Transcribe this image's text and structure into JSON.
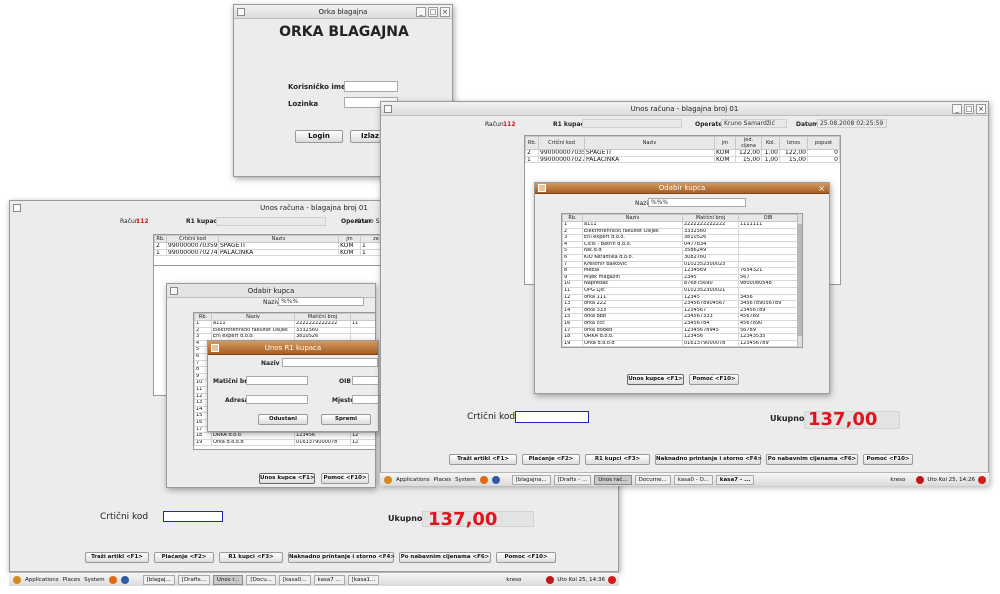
{
  "colors": {
    "accent": "#e0141c",
    "dialog_title": "#a65e25",
    "input_blue": "#1c27b8"
  },
  "login": {
    "title": "Orka blagajna",
    "heading": "ORKA BLAGAJNA",
    "user_label": "Korisničko ime",
    "pass_label": "Lozinka",
    "login_btn": "Login",
    "exit_btn": "Izlaz"
  },
  "back": {
    "title": "Unos računa - blagajna broj  01",
    "racun_label": "Račun",
    "racun_value": "112",
    "r1_label": "R1 kupac",
    "operator_label": "Operater",
    "operator_value": "Kruno Samar",
    "columns": [
      "Rb.",
      "Crtični kod",
      "Naziv",
      "jm",
      "ze"
    ],
    "rows": [
      [
        "2",
        "9900000070359",
        "ŠPAGETI",
        "KOM",
        "1"
      ],
      [
        "1",
        "9900000070274",
        "PALAČINKA",
        "KOM",
        "1"
      ]
    ],
    "barcode_label": "Crtični kod",
    "total_label": "Ukupno:",
    "total_value": "137,00",
    "buttons": [
      "Traži artikl <F1>",
      "Plaćanje <F2>",
      "R1 kupci <F3>",
      "Naknadno printanje i storno <F4>",
      "Po nabavnim cijenama <F6>",
      "Pomoć <F10>"
    ],
    "dialog": {
      "title": "Odabir kupca",
      "naziv_label": "Naziv",
      "naziv_value": "%%%",
      "columns": [
        "Rb.",
        "Naziv",
        "Matični broj",
        ""
      ],
      "rows": [
        [
          "1",
          "a111",
          "2222222222222",
          "11"
        ],
        [
          "2",
          "Elektrotehnički fakultet Osijek",
          "3332560",
          ""
        ],
        [
          "3",
          "Eni expert d.o.o.",
          "3810526",
          ""
        ],
        [
          "4",
          "",
          "",
          ""
        ],
        [
          "5",
          "",
          "",
          ""
        ],
        [
          "6",
          "",
          "",
          ""
        ],
        [
          "7",
          "",
          "",
          ""
        ],
        [
          "8",
          "",
          "",
          ""
        ],
        [
          "9",
          "",
          "",
          ""
        ],
        [
          "10",
          "",
          "",
          ""
        ],
        [
          "11",
          "",
          "",
          ""
        ],
        [
          "12",
          "",
          "",
          ""
        ],
        [
          "13",
          "",
          "",
          ""
        ],
        [
          "14",
          "",
          "",
          ""
        ],
        [
          "15",
          "",
          "",
          ""
        ],
        [
          "16",
          "",
          "",
          ""
        ],
        [
          "17",
          "",
          "",
          ""
        ],
        [
          "18",
          "DRKA d.o.o.",
          "123456",
          "12"
        ],
        [
          "19",
          "Orka d.o.o.d",
          "0161379000078",
          "12"
        ]
      ],
      "ok_btn": "Unos kupca <F1>",
      "help_btn": "Pomoć <F10>"
    },
    "r1dialog": {
      "title": "Unos R1 kupaca",
      "naziv_label": "Naziv",
      "mb_label": "Matični broj",
      "oib_label": "OIB",
      "adresa_label": "Adresa",
      "mjesto_label": "Mjesto",
      "cancel_btn": "Odustani",
      "save_btn": "Spremi"
    }
  },
  "front": {
    "title": "Unos računa - blagajna broj  01",
    "racun_label": "Račun",
    "racun_value": "112",
    "r1_label": "R1 kupac",
    "operator_label": "Operater",
    "operator_value": "Kruno Samardžić",
    "datum_label": "Datum",
    "datum_value": "25.08.2008  02:25:59",
    "columns": [
      "Rb.",
      "Crtični kod",
      "Naziv",
      "jm",
      "jed. cijena",
      "Kol.",
      "Iznos",
      "popust"
    ],
    "rows": [
      [
        "2",
        "9900000070359",
        "ŠPAGETI",
        "KOM",
        "122,00",
        "1,00",
        "122,00",
        "0"
      ],
      [
        "1",
        "9900000070274",
        "PALAČINKA",
        "KOM",
        "15,00",
        "1,00",
        "15,00",
        "0"
      ]
    ],
    "barcode_label": "Crtični kod",
    "total_label": "Ukupno:",
    "total_value": "137,00",
    "buttons": [
      "Traži artikl <F1>",
      "Plaćanje <F2>",
      "R1 kupci <F3>",
      "Naknadno printanje i storno <F4>",
      "Po nabavnim cijenama <F6>",
      "Pomoć <F10>"
    ],
    "dialog": {
      "title": "Odabir kupca",
      "naziv_label": "Naziv",
      "naziv_value": "%%%",
      "columns": [
        "Rb.",
        "Naziv",
        "Matični broj",
        "OIB"
      ],
      "rows": [
        [
          "1",
          "a111",
          "2222222222222",
          "1111111"
        ],
        [
          "2",
          "Elektrotehnički fakultet Osijek",
          "3332560",
          ""
        ],
        [
          "3",
          "Eni expert d.o.o.",
          "3810526",
          ""
        ],
        [
          "4",
          "Ciciš - Batrin d.o.o.",
          "0477834",
          ""
        ],
        [
          "5",
          "Nik.d.d",
          "3586249",
          ""
        ],
        [
          "6",
          "KIO Keramika d.o.o.",
          "3082760",
          ""
        ],
        [
          "7",
          "Krešimir Balković",
          "0102352300023",
          ""
        ],
        [
          "8",
          "Mebla",
          "1234569",
          "7654321"
        ],
        [
          "9",
          "Mijek magazin",
          "2345",
          "567"
        ],
        [
          "10",
          "Napredak",
          "876875690",
          "9800080548"
        ],
        [
          "11",
          "OPG Ljić",
          "0102352300021",
          ""
        ],
        [
          "12",
          "orka 111",
          "12345",
          "3456"
        ],
        [
          "13",
          "orka 222",
          "2345678904567",
          "3456789056789"
        ],
        [
          "14",
          "orka 333",
          "1234567",
          "23456789"
        ],
        [
          "15",
          "orka bbb",
          "234567333",
          "456789"
        ],
        [
          "16",
          "orka ccc",
          "23456784",
          "4567890"
        ],
        [
          "17",
          "orka doded",
          "12345678945",
          "56789"
        ],
        [
          "18",
          "ORKA d.o.o.",
          "123456",
          "12343535"
        ],
        [
          "19",
          "Orka d.o.o.d",
          "0161379000078",
          "123456789"
        ]
      ],
      "ok_btn": "Unos kupca <F1>",
      "help_btn": "Pomoć <F10>"
    }
  },
  "taskbar_back": {
    "apps": "Applications",
    "places": "Places",
    "system": "System",
    "tasks": [
      "[blagaj...",
      "[Drafts...",
      "Unos r...",
      "[Docu...",
      "[kasa0...",
      "kasa7 ...",
      "[kasa1..."
    ],
    "user": "kreso",
    "clock": "Uto Kol 25, 14:36"
  },
  "taskbar_front": {
    "apps": "Applications",
    "places": "Places",
    "system": "System",
    "tasks": [
      "[blagajna...",
      "[Drafts - ...",
      "Unos rač...",
      "Docume...",
      "kasa0 - O...",
      "kasa7 - ..."
    ],
    "user": "kreso",
    "clock": "Uto Kol 25, 14:26"
  }
}
